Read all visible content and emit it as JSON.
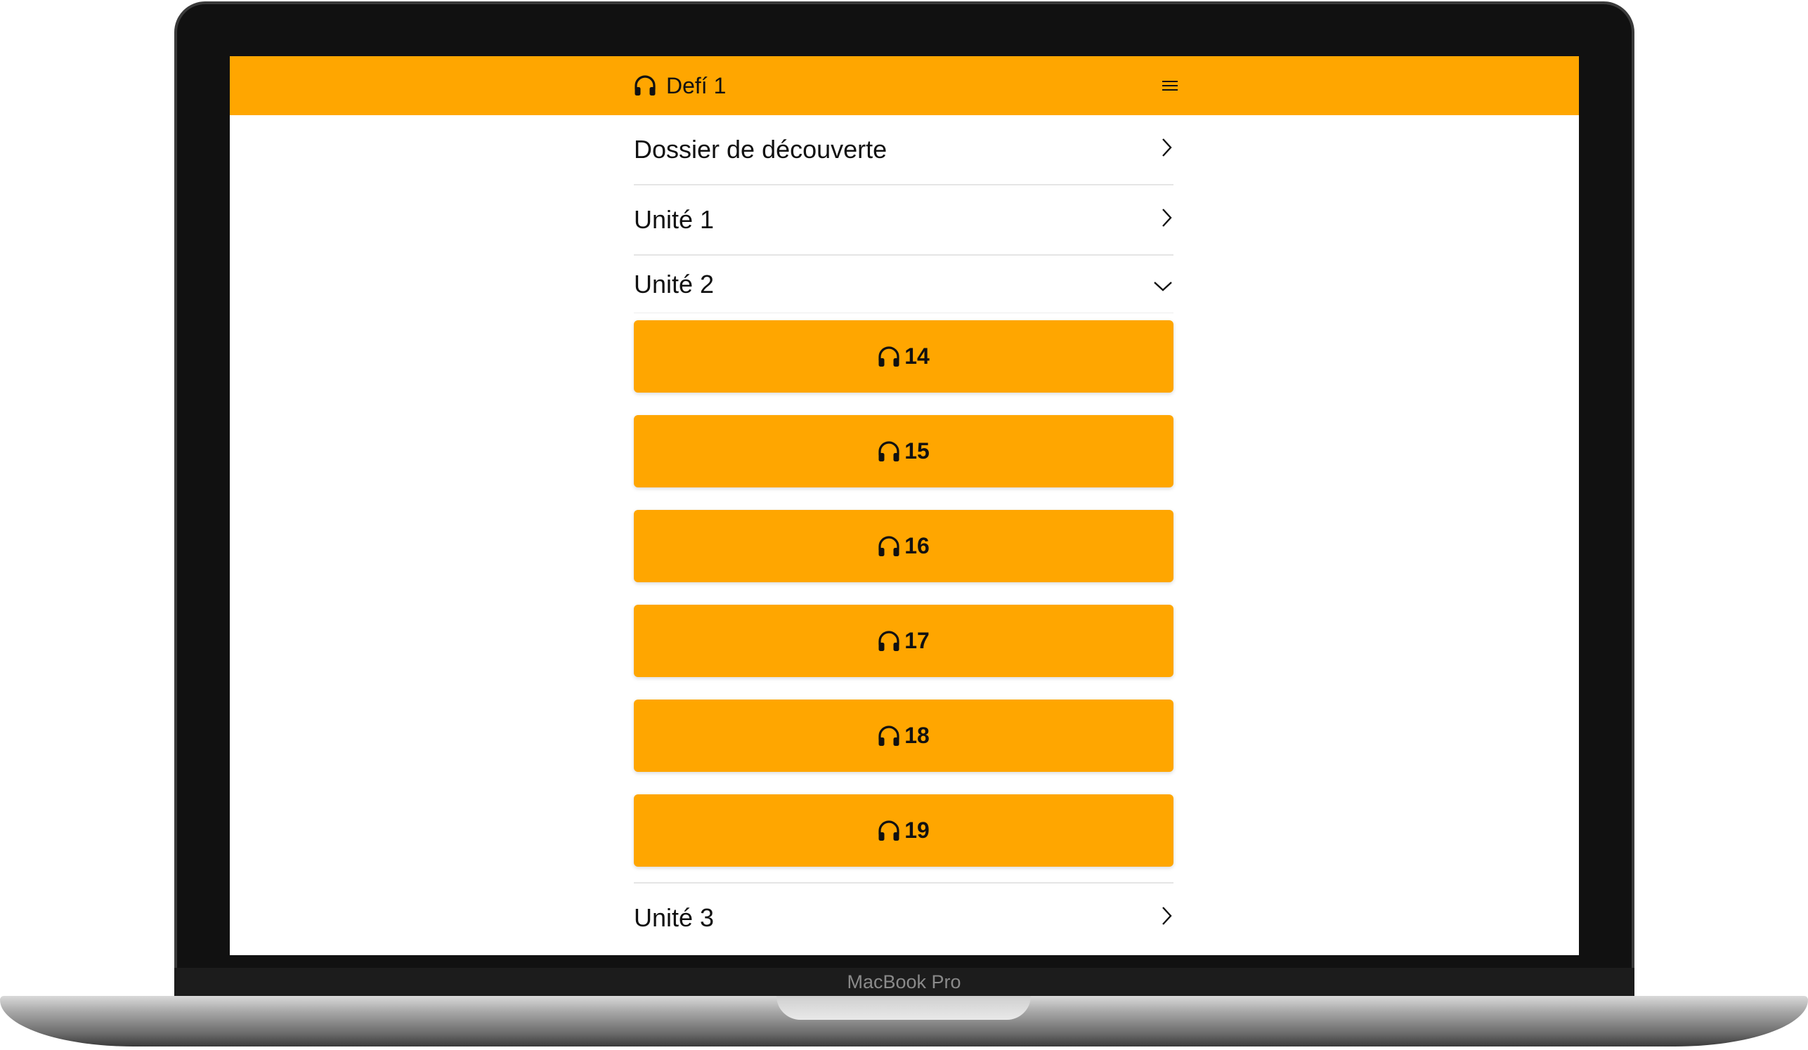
{
  "device": {
    "brand_label": "MacBook Pro"
  },
  "header": {
    "title": "Defí 1",
    "icon": "headphones-icon",
    "menu_icon": "hamburger-menu-icon"
  },
  "sections": [
    {
      "label": "Dossier de découverte",
      "state": "collapsed",
      "icon": "chevron-right-icon"
    },
    {
      "label": "Unité 1",
      "state": "collapsed",
      "icon": "chevron-right-icon"
    },
    {
      "label": "Unité 2",
      "state": "expanded",
      "icon": "chevron-down-icon",
      "tracks": [
        "14",
        "15",
        "16",
        "17",
        "18",
        "19"
      ]
    },
    {
      "label": "Unité 3",
      "state": "collapsed",
      "icon": "chevron-right-icon"
    }
  ],
  "colors": {
    "accent": "#ffa600",
    "text": "#111111",
    "divider": "#e5e5e5"
  }
}
